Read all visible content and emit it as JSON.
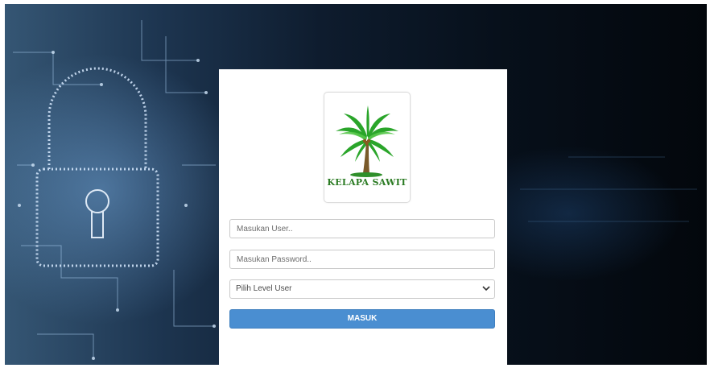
{
  "background": {
    "image": "padlock-circuit-background",
    "colors": {
      "light": "#6fa3d4",
      "dark": "#03070c"
    }
  },
  "logo": {
    "text": "KELAPA SAWIT",
    "icon": "palm-tree-icon",
    "color": "#2a7a22"
  },
  "form": {
    "user_placeholder": "Masukan User..",
    "password_placeholder": "Masukan Password..",
    "level_select": {
      "selected": "Pilih Level User",
      "icon": "chevron-down-icon"
    },
    "submit_label": "MASUK"
  },
  "colors": {
    "button": "#4a8ed1",
    "panel": "#ffffff"
  }
}
